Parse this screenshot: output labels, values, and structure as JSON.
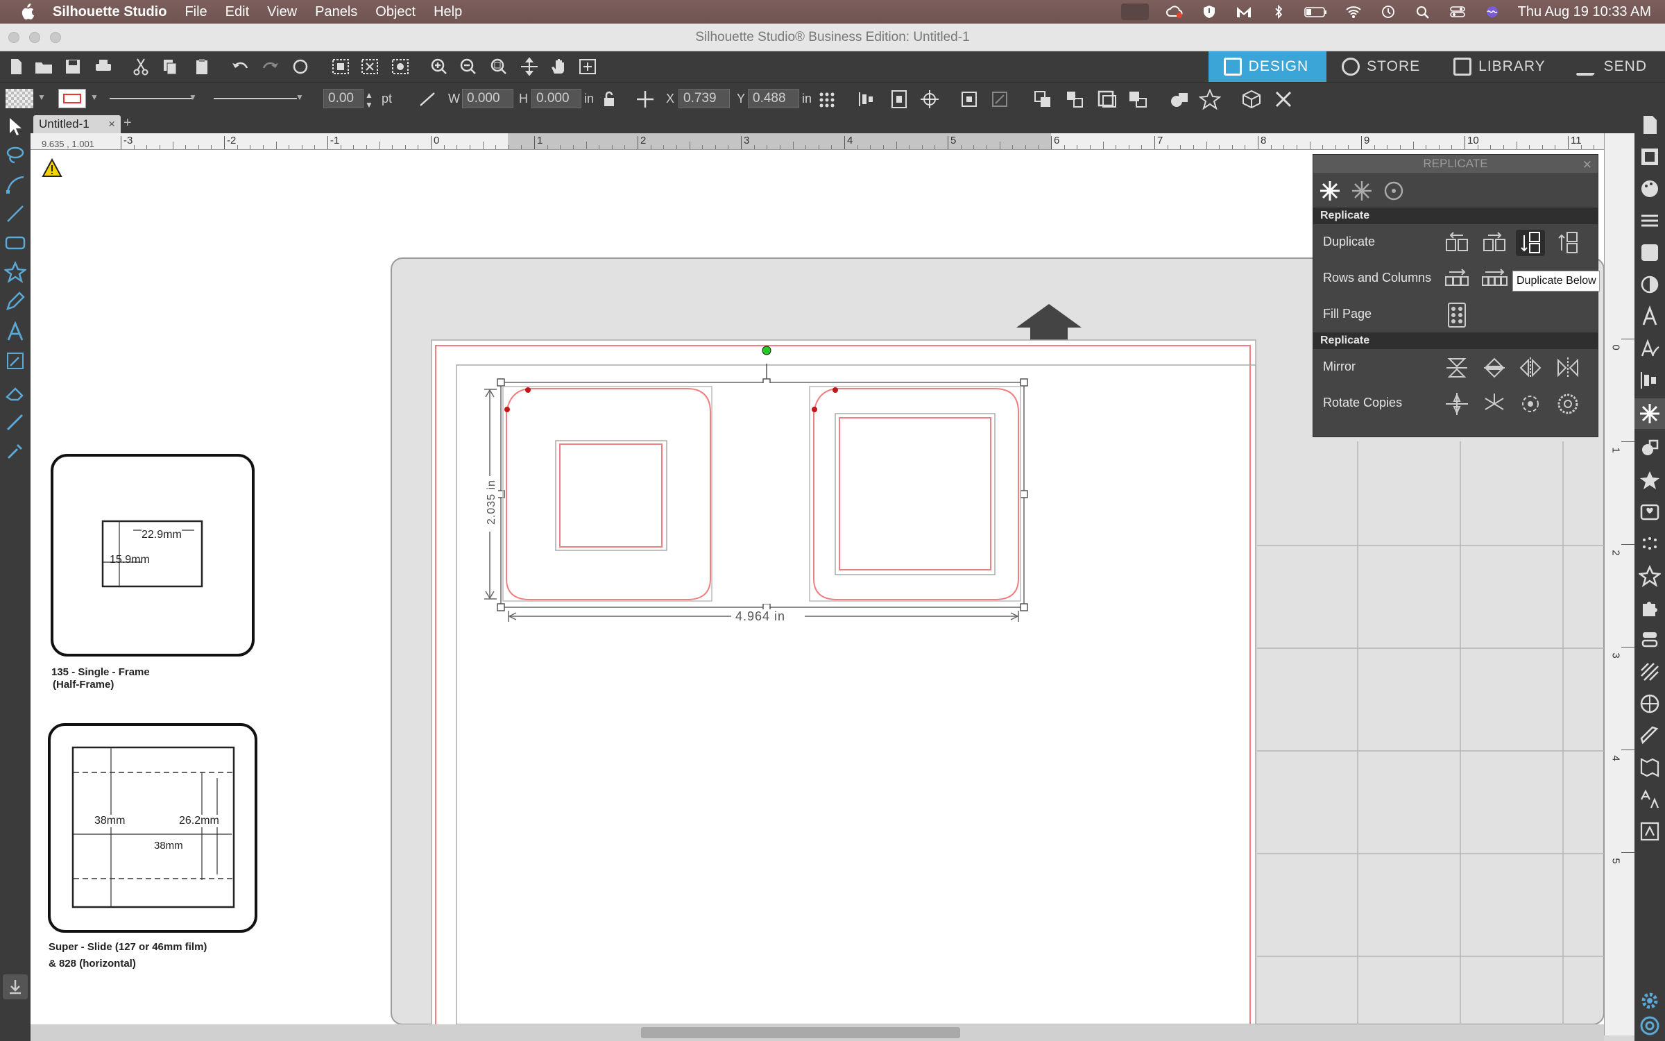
{
  "menubar": {
    "app_name": "Silhouette Studio",
    "menus": [
      "File",
      "Edit",
      "View",
      "Panels",
      "Object",
      "Help"
    ],
    "datetime": "Thu Aug 19  10:33 AM"
  },
  "window": {
    "title": "Silhouette Studio® Business Edition: Untitled-1"
  },
  "modes": [
    {
      "label": "DESIGN",
      "active": true
    },
    {
      "label": "STORE",
      "active": false
    },
    {
      "label": "LIBRARY",
      "active": false
    },
    {
      "label": "SEND",
      "active": false
    }
  ],
  "toolbar2": {
    "line_width": "0.00",
    "line_unit": "pt",
    "w_label": "W",
    "w_value": "0.000",
    "h_label": "H",
    "h_value": "0.000",
    "size_unit": "in",
    "x_label": "X",
    "x_value": "0.739",
    "y_label": "Y",
    "y_value": "0.488",
    "pos_unit": "in"
  },
  "doc_tab": {
    "label": "Untitled-1",
    "close": "×",
    "add": "+"
  },
  "ruler": {
    "coord": "9.635 , 1.001",
    "h_ticks": [
      "-3",
      "-2",
      "-1",
      "0",
      "1",
      "2",
      "3",
      "4",
      "5",
      "6",
      "7",
      "8",
      "9",
      "10",
      "11"
    ],
    "v_ticks": [
      "0",
      "1",
      "2",
      "3",
      "4",
      "5"
    ]
  },
  "canvas": {
    "height_dim": "2.035 in",
    "width_dim": "4.964 in",
    "ref1_inner_w": "22.9mm",
    "ref1_inner_h": "15.9mm",
    "ref1_caption_1": "135 - Single - Frame",
    "ref1_caption_2": "(Half-Frame)",
    "ref2_w1": "38mm",
    "ref2_h": "26.2mm",
    "ref2_w2": "38mm",
    "ref2_caption_1": "Super - Slide (127  or 46mm film)",
    "ref2_caption_2": "& 828 (horizontal)"
  },
  "replicate_panel": {
    "title": "REPLICATE",
    "close": "✕",
    "section1": "Replicate",
    "row_duplicate": "Duplicate",
    "row_rows_columns": "Rows and Columns",
    "row_fill_page": "Fill Page",
    "section2": "Replicate",
    "row_mirror": "Mirror",
    "row_rotate": "Rotate Copies",
    "tooltip": "Duplicate Below"
  },
  "colors": {
    "accent": "#3aa5d6",
    "cut_line": "#f07070",
    "panel_bg": "#454545",
    "toolbar_bg": "#3b3b3b"
  }
}
